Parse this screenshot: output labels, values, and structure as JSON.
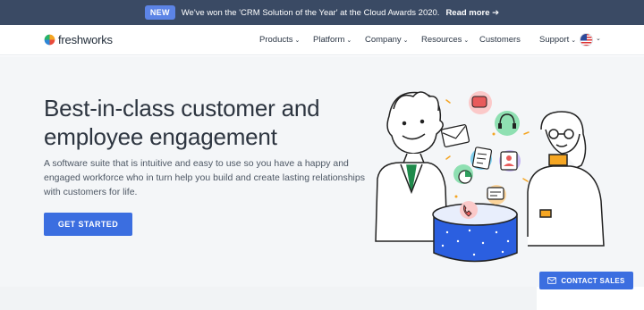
{
  "announcement": {
    "badge": "NEW",
    "message": "We've won the 'CRM Solution of the Year' at the Cloud Awards 2020.",
    "link": "Read more ➔"
  },
  "nav": {
    "logo_text": "freshworks",
    "items": [
      "Products",
      "Platform",
      "Company",
      "Resources",
      "Customers",
      "Support"
    ]
  },
  "hero": {
    "headline": "Best-in-class customer and employee engagement",
    "subtext": "A software suite that is intuitive and easy to use so you have a happy and engaged workforce who in turn help you build and create lasting relationships with customers for life.",
    "cta": "GET STARTED"
  },
  "contact_sales": "CONTACT SALES",
  "colors": {
    "announce_bg": "#3a4a64",
    "accent": "#3b6ee0",
    "hero_bg": "#f4f6f8"
  },
  "icons": [
    "freshworks-logo",
    "chevron-down-icon",
    "us-flag-icon",
    "mail-icon",
    "headset-icon",
    "chat-icon",
    "phone-icon",
    "user-icon",
    "document-icon",
    "chart-icon"
  ]
}
